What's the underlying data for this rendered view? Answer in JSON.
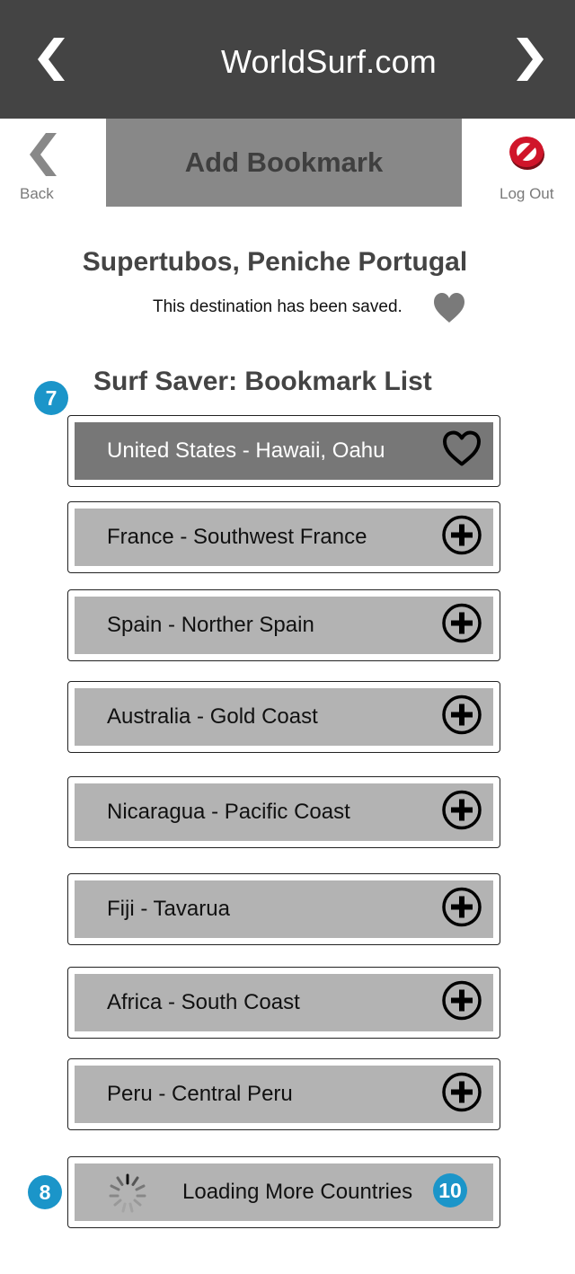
{
  "header": {
    "title": "WorldSurf.com",
    "prev_icon": "chevron-left-icon",
    "next_icon": "chevron-right-icon"
  },
  "subnav": {
    "back_label": "Back",
    "tab_label": "Add Bookmark",
    "logout_label": "Log Out"
  },
  "destination": {
    "name": "Supertubos, Peniche Portugal",
    "saved_message": "This destination has been saved."
  },
  "bookmark_list": {
    "title": "Surf Saver: Bookmark List",
    "items": [
      {
        "label": "United States - Hawaii, Oahu",
        "icon": "heart-outline-icon",
        "active": true
      },
      {
        "label": "France - Southwest France",
        "icon": "plus-circle-icon"
      },
      {
        "label": "Spain - Norther Spain",
        "icon": "plus-circle-icon"
      },
      {
        "label": "Australia - Gold Coast",
        "icon": "plus-circle-icon"
      },
      {
        "label": "Nicaragua - Pacific Coast",
        "icon": "plus-circle-icon"
      },
      {
        "label": "Fiji - Tavarua",
        "icon": "plus-circle-icon"
      },
      {
        "label": "Africa - South Coast",
        "icon": "plus-circle-icon"
      },
      {
        "label": "Peru - Central Peru",
        "icon": "plus-circle-icon"
      }
    ],
    "loading_label": "Loading More Countries"
  },
  "annotations": {
    "badge_list": "7",
    "badge_loading": "8",
    "badge_loading_end": "10"
  },
  "colors": {
    "header_bg": "#444444",
    "tab_bg": "#888888",
    "item_bg": "#b3b3b3",
    "item_active_bg": "#777777",
    "badge": "#1b95c9",
    "logout_red": "#d0152a"
  }
}
